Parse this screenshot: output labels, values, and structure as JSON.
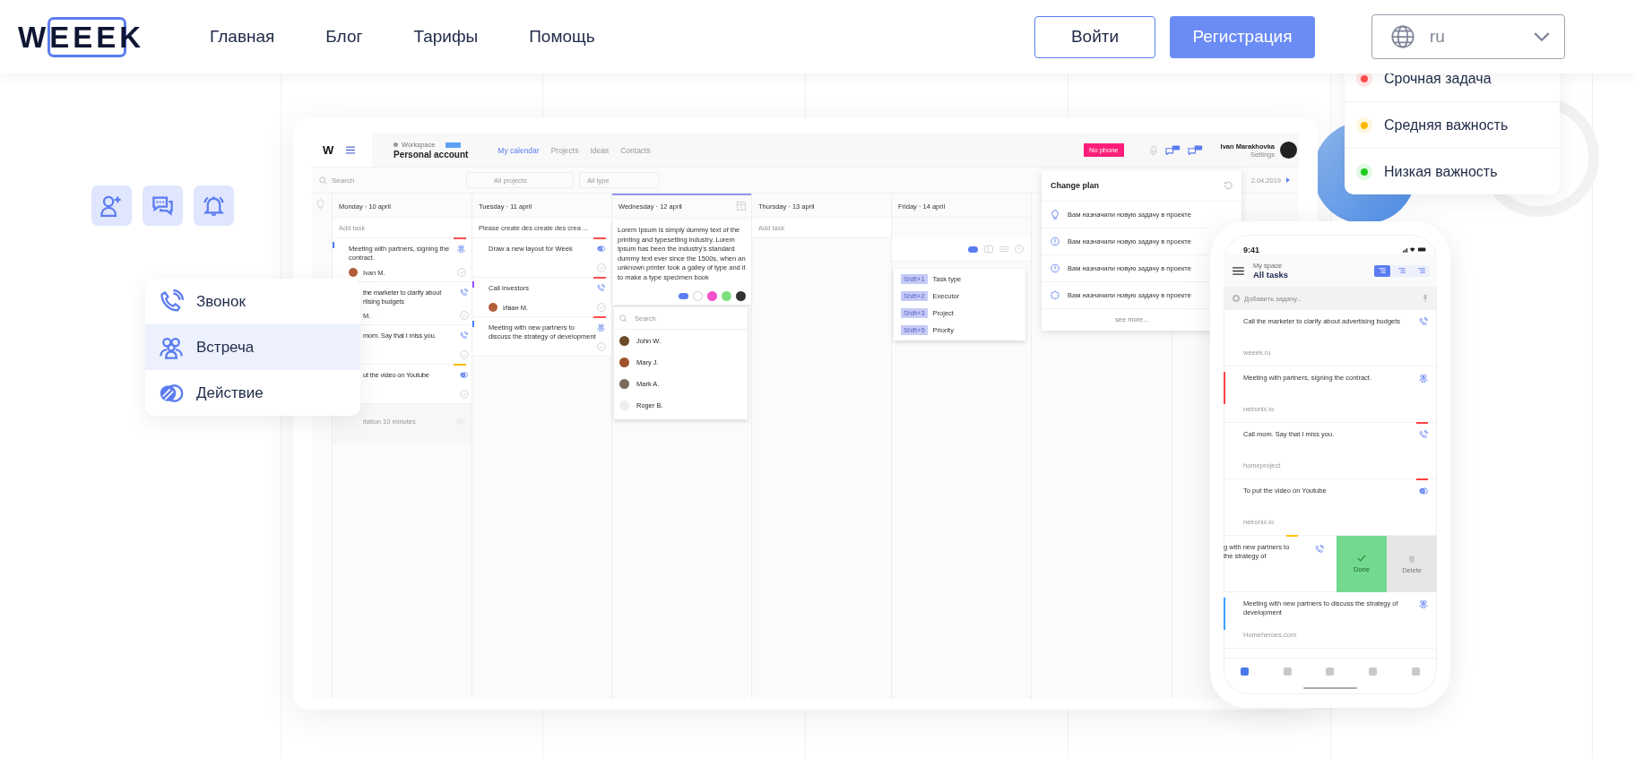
{
  "header": {
    "logo": "WEEEK",
    "nav": [
      {
        "label": "Главная"
      },
      {
        "label": "Блог"
      },
      {
        "label": "Тарифы"
      },
      {
        "label": "Помощь"
      }
    ],
    "login": "Войти",
    "register": "Регистрация",
    "language": "ru"
  },
  "task_types": [
    {
      "label": "Звонок",
      "kind": "call",
      "selected": false
    },
    {
      "label": "Встреча",
      "kind": "meeting",
      "selected": true
    },
    {
      "label": "Действие",
      "kind": "action",
      "selected": false
    }
  ],
  "priorities": [
    {
      "label": "Срочная задача",
      "color": "#ff4d4d"
    },
    {
      "label": "Средняя важность",
      "color": "#ffb800"
    },
    {
      "label": "Низкая важность",
      "color": "#1fcc1f"
    }
  ],
  "app": {
    "logo": "W",
    "workspace": "Workspace",
    "account": "Personal account",
    "tabs": [
      {
        "label": "My calendar",
        "selected": true
      },
      {
        "label": "Projects",
        "selected": false
      },
      {
        "label": "Ideas",
        "selected": false
      },
      {
        "label": "Contacts",
        "selected": false
      }
    ],
    "no_phone": "No phone",
    "user": "Ivan Marakhovka",
    "settings": "Settings",
    "search_placeholder": "Search",
    "filters": [
      "All projects",
      "All type"
    ],
    "date": "2.04.2019"
  },
  "days": [
    {
      "label": "Monday · 10 april",
      "selected": false,
      "add_task": {
        "placeholder": "Add task"
      },
      "tasks": [
        {
          "title": "Meeting with partners, signing the contract.",
          "user": "Ivan M.",
          "kind": "meeting",
          "color": "#ff4d4d"
        },
        {
          "title": "the marketer to clarify about\nrtising budgets",
          "user": "M.",
          "kind": "call"
        },
        {
          "title": "mom. Say that I miss you.",
          "kind": "call"
        },
        {
          "title": "ut the video on Youtube",
          "kind": "action",
          "color": "#ffb800"
        }
      ],
      "footer": "itation 10 minutes"
    },
    {
      "label": "Tuesday · 11 april",
      "selected": false,
      "add_task": {
        "value": "Please create des create des crea ..."
      },
      "tasks": [
        {
          "title": "Draw a new layout for Week",
          "kind": "action",
          "color": "#ff4d4d"
        },
        {
          "title": "Call investors",
          "user": "Иван М.",
          "kind": "call",
          "color": "#ff4d4d"
        },
        {
          "title": "Meeting with new partners to discuss the strategy of development",
          "kind": "meeting",
          "color": "#ff4d4d"
        }
      ]
    },
    {
      "label": "Wednesday · 12 april",
      "selected": true,
      "note": "Lorem Ipsum is simply dummy text of the printing and typesetting industry. Lorem Ipsum has been the industry's standard dummy text ever since the 1500s, when an unknown printer took a galley of type and it to make a type specimen book",
      "assignees": {
        "placeholder": "Search",
        "people": [
          "John W.",
          "Mary J.",
          "Mark A.",
          "Roger B."
        ]
      }
    },
    {
      "label": "Thursday · 13 april",
      "selected": false,
      "add_task": {
        "placeholder": "Add task"
      }
    },
    {
      "label": "Friday · 14 april",
      "selected": false,
      "toolbar": true,
      "shortcuts": [
        {
          "keys": "Shift+1",
          "label": "Task type"
        },
        {
          "keys": "Shift+2",
          "label": "Executor"
        },
        {
          "keys": "Shift+3",
          "label": "Project"
        },
        {
          "keys": "Shift+5",
          "label": "Priority"
        }
      ]
    }
  ],
  "change_plan": {
    "title": "Change plan",
    "items": [
      {
        "kind": "idea",
        "text": "Вам назначили новую задачу в проекте"
      },
      {
        "kind": "alert",
        "text": "Вам назначили новую задачу в проекте"
      },
      {
        "kind": "alert",
        "text": "Вам назначили новую задачу в проекте"
      },
      {
        "kind": "hex",
        "text": "Вам назначили новую задачу в проекте"
      }
    ],
    "more": "see more..."
  },
  "phone": {
    "time": "9:41",
    "space": "My space",
    "title": "All tasks",
    "views": [
      {
        "selected": true
      },
      {
        "selected": false
      },
      {
        "selected": false
      }
    ],
    "add_placeholder": "Добавить задачу...",
    "tasks": [
      {
        "title": "Call the marketer to clarify about advertising budgets",
        "project": "weeek.ru",
        "kind": "call"
      },
      {
        "title": "Meeting with partners, signing the contract.",
        "project": "neironix.io",
        "kind": "meeting",
        "stripe": true,
        "color": "#ff4040"
      },
      {
        "title": "Call mom. Say that I miss you.",
        "project": "homeproject",
        "kind": "call",
        "stripe": false,
        "color": "#ff4040"
      },
      {
        "title": "To put the video on Youtube",
        "project": "neironix.io",
        "kind": "action",
        "stripe": false,
        "color": "#ff4040"
      },
      {
        "title": "g with new partners to\nthe strategy of",
        "kind": "call",
        "stripe": false,
        "color": "#ffc400",
        "swiped": true,
        "done": "Done",
        "delete": "Delete"
      },
      {
        "title": "Meeting with new partners to discuss the strategy of development",
        "project": "Homeheroes.com",
        "kind": "meeting",
        "stripe": true,
        "color": "#3aa0ff"
      }
    ],
    "tabs": [
      {
        "selected": true
      },
      {
        "selected": false
      },
      {
        "selected": false
      },
      {
        "selected": false
      },
      {
        "selected": false
      }
    ]
  }
}
